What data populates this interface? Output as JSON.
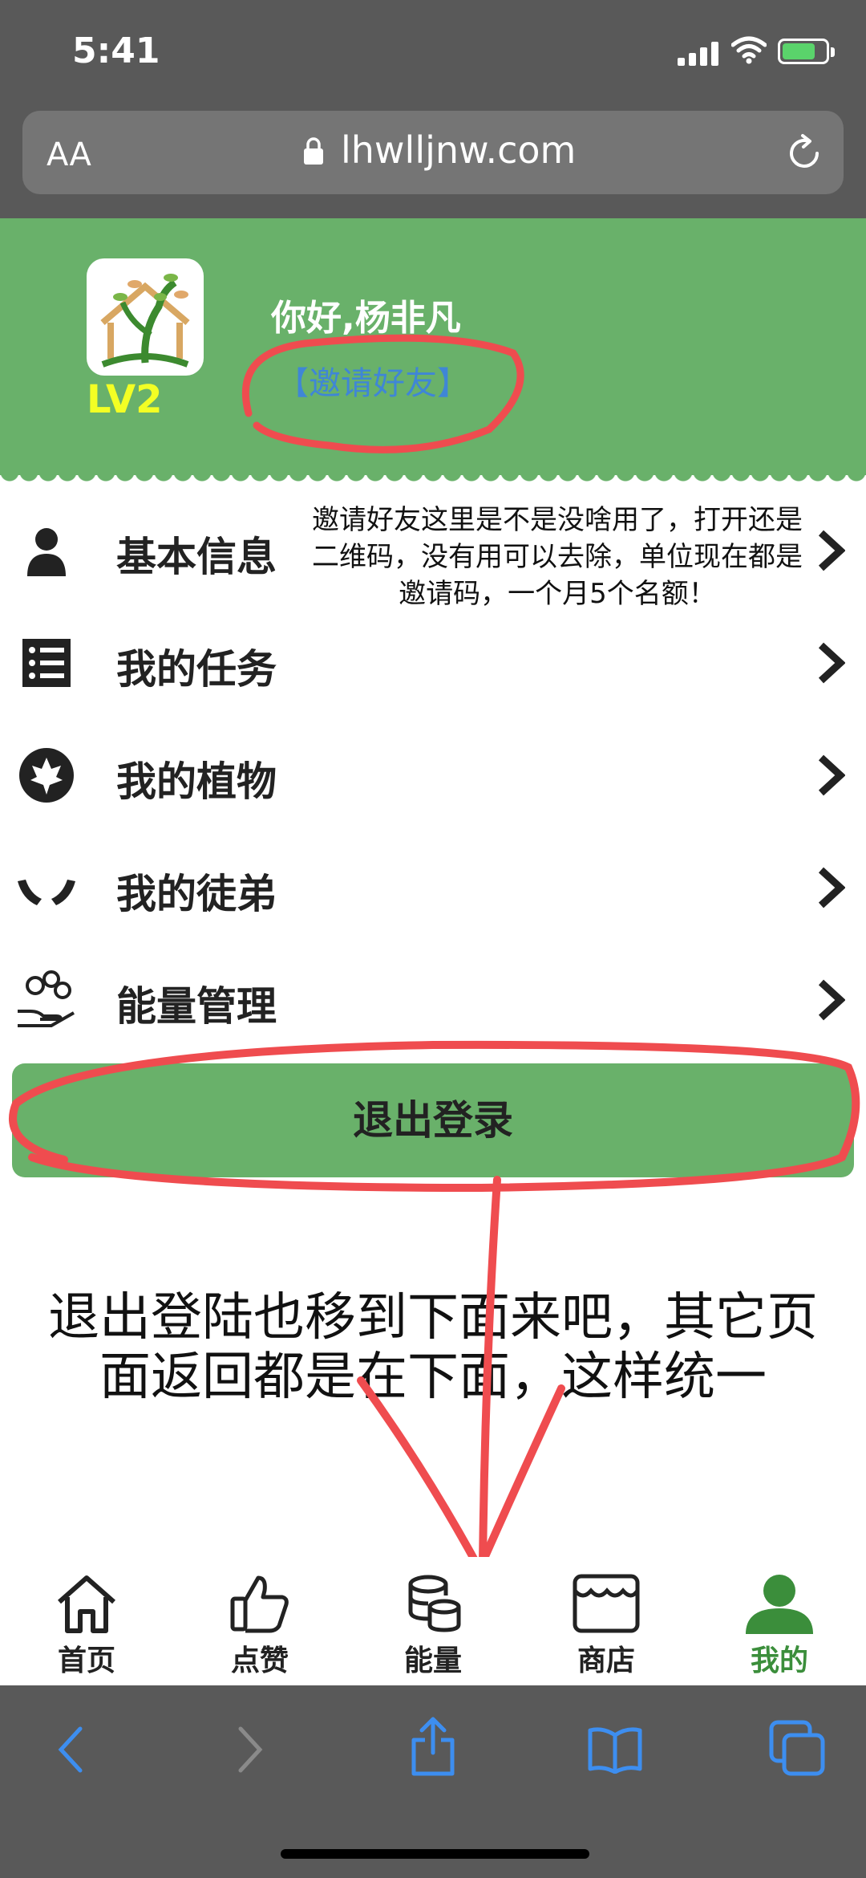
{
  "status": {
    "time": "5:41"
  },
  "browser": {
    "text_size": "AA",
    "url": "lhwlljnw.com"
  },
  "profile": {
    "level": "LV2",
    "greeting": "你好,杨非凡",
    "invite_link": "【邀请好友】"
  },
  "menu": [
    {
      "label": "基本信息",
      "icon": "person-icon"
    },
    {
      "label": "我的任务",
      "icon": "task-list-icon"
    },
    {
      "label": "我的植物",
      "icon": "leaf-icon"
    },
    {
      "label": "我的徒弟",
      "icon": "hands-icon"
    },
    {
      "label": "能量管理",
      "icon": "coins-hand-icon"
    }
  ],
  "annotations": {
    "invite_note": "邀请好友这里是不是没啥用了，打开还是二维码，没有用可以去除，单位现在都是邀请码，一个月5个名额！",
    "logout_note": "退出登陆也移到下面来吧，其它页面返回都是在下面，这样统一"
  },
  "logout_label": "退出登录",
  "tabbar": [
    {
      "label": "首页",
      "icon": "home-icon"
    },
    {
      "label": "点赞",
      "icon": "thumbs-up-icon"
    },
    {
      "label": "能量",
      "icon": "energy-coins-icon"
    },
    {
      "label": "商店",
      "icon": "store-icon"
    },
    {
      "label": "我的",
      "icon": "user-icon",
      "active": true
    }
  ],
  "colors": {
    "brand_green": "#69b16a",
    "active_tab": "#3b8e3b",
    "link_blue": "#3f86d6",
    "level_yellow": "#f3ff24",
    "annotation_red": "#ef4c4f",
    "chrome_gray": "#595959"
  }
}
